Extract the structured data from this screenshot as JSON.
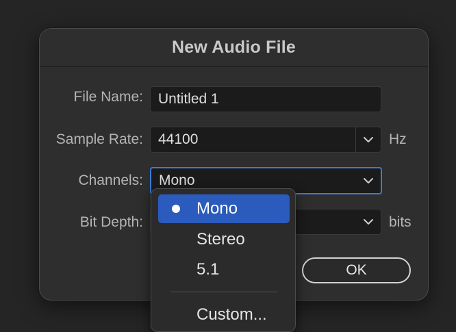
{
  "dialog": {
    "title": "New Audio File",
    "file_name": {
      "label": "File Name:",
      "value": "Untitled 1"
    },
    "sample_rate": {
      "label": "Sample Rate:",
      "value": "44100",
      "unit": "Hz"
    },
    "channels": {
      "label": "Channels:",
      "value": "Mono"
    },
    "bit_depth": {
      "label": "Bit Depth:",
      "unit": "bits"
    },
    "ok_label": "OK"
  },
  "channels_menu": {
    "items": [
      {
        "label": "Mono",
        "selected": true
      },
      {
        "label": "Stereo",
        "selected": false
      },
      {
        "label": "5.1",
        "selected": false
      }
    ],
    "custom_label": "Custom..."
  },
  "colors": {
    "accent": "#2b5bbd",
    "focus_ring": "#3e7bd6",
    "dialog_bg": "#2e2e2e",
    "page_bg": "#252525"
  }
}
